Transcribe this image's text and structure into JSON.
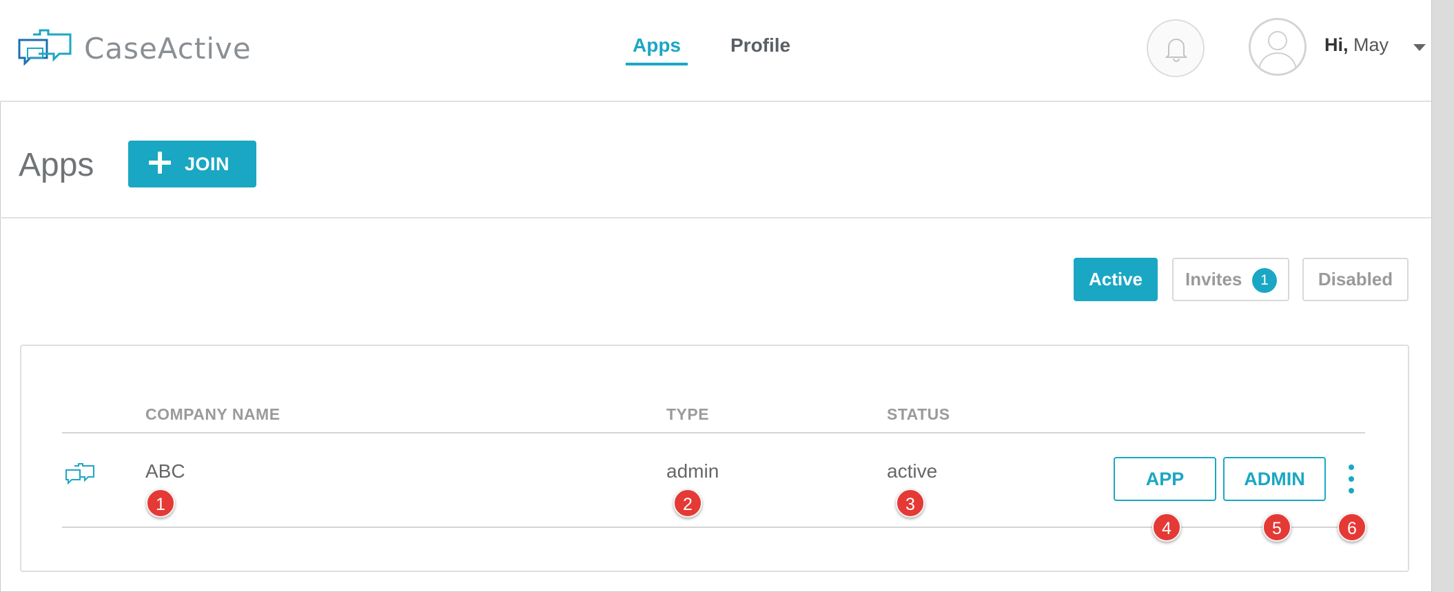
{
  "colors": {
    "accent": "#1aa7c3",
    "marker": "#e53935",
    "text": "#555555",
    "muted": "#9a9a9a"
  },
  "header": {
    "brand": "CaseActive",
    "nav": [
      {
        "label": "Apps",
        "active": true
      },
      {
        "label": "Profile",
        "active": false
      }
    ],
    "notification_icon": "bell-icon",
    "avatar_icon": "user-avatar-icon",
    "greeting_hi": "Hi,",
    "greeting_name": "May"
  },
  "page": {
    "title": "Apps",
    "join_label": "JOIN"
  },
  "filters": {
    "active_label": "Active",
    "invites_label": "Invites",
    "invites_count": "1",
    "disabled_label": "Disabled"
  },
  "table": {
    "columns": [
      "COMPANY NAME",
      "TYPE",
      "STATUS"
    ],
    "rows": [
      {
        "company": "ABC",
        "type": "admin",
        "status": "active",
        "app_label": "APP",
        "admin_label": "ADMIN"
      }
    ]
  },
  "markers": [
    "1",
    "2",
    "3",
    "4",
    "5",
    "6"
  ]
}
